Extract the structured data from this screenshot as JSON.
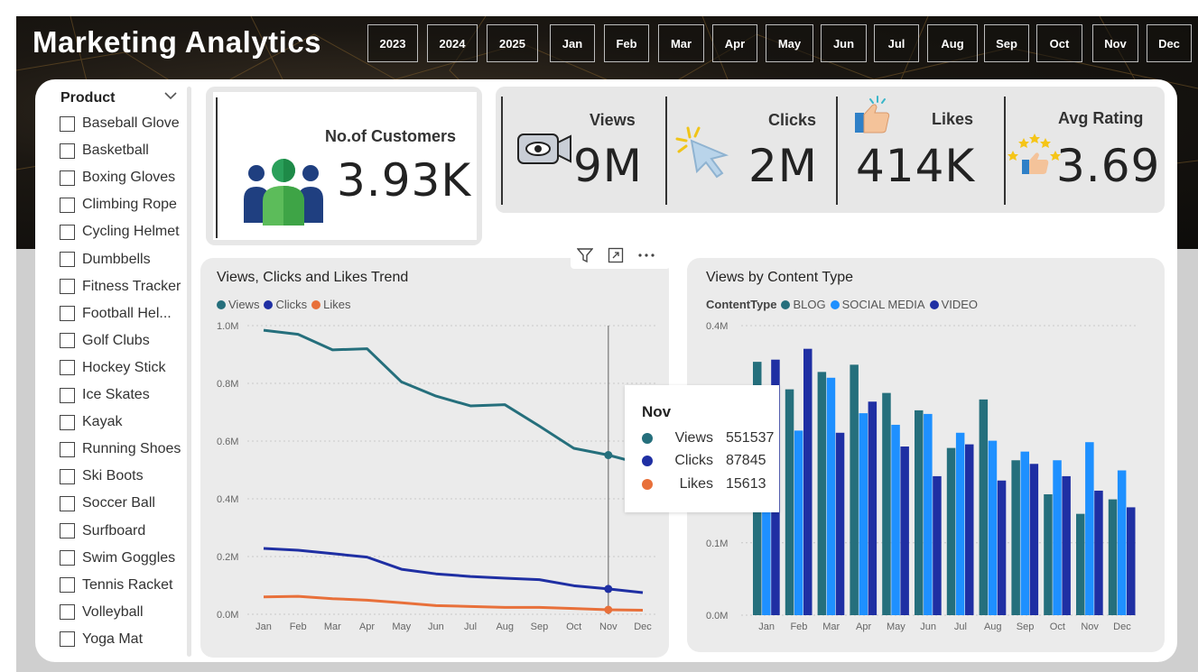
{
  "header": {
    "title": "Marketing Analytics",
    "year_buttons": [
      "2023",
      "2024",
      "2025"
    ],
    "month_buttons": [
      "Jan",
      "Feb",
      "Mar",
      "Apr",
      "May",
      "Jun",
      "Jul",
      "Aug",
      "Sep",
      "Oct",
      "Nov",
      "Dec"
    ]
  },
  "slicer": {
    "title": "Product",
    "chevron_icon": "chevron-down-icon",
    "items": [
      "Baseball Glove",
      "Basketball",
      "Boxing Gloves",
      "Climbing Rope",
      "Cycling Helmet",
      "Dumbbells",
      "Fitness Tracker",
      "Football Hel...",
      "Golf Clubs",
      "Hockey Stick",
      "Ice Skates",
      "Kayak",
      "Running Shoes",
      "Ski Boots",
      "Soccer Ball",
      "Surfboard",
      "Swim Goggles",
      "Tennis Racket",
      "Volleyball",
      "Yoga Mat"
    ]
  },
  "kpis": {
    "customers": {
      "label": "No.of Customers",
      "value": "3.93K",
      "icon": "people-icon"
    },
    "views": {
      "label": "Views",
      "value": "9M",
      "icon": "camera-eye-icon"
    },
    "clicks": {
      "label": "Clicks",
      "value": "2M",
      "icon": "cursor-click-icon"
    },
    "likes": {
      "label": "Likes",
      "value": "414K",
      "icon": "thumbs-up-icon"
    },
    "rating": {
      "label": "Avg Rating",
      "value": "3.69",
      "icon": "star-rating-icon"
    }
  },
  "visual_header_icons": [
    "filter-icon",
    "focus-mode-icon",
    "more-options-icon"
  ],
  "colors": {
    "views": "#256f7c",
    "clicks": "#1f2fa3",
    "likes": "#e8703a",
    "blog": "#256f7c",
    "social_media": "#1e90ff",
    "video": "#1f2fa3"
  },
  "tooltip": {
    "title": "Nov",
    "rows": [
      {
        "name": "Views",
        "value": "551537"
      },
      {
        "name": "Clicks",
        "value": "87845"
      },
      {
        "name": "Likes",
        "value": "15613"
      }
    ]
  },
  "chart_data": [
    {
      "type": "line",
      "title": "Views, Clicks and Likes Trend",
      "categories": [
        "Jan",
        "Feb",
        "Mar",
        "Apr",
        "May",
        "Jun",
        "Jul",
        "Aug",
        "Sep",
        "Oct",
        "Nov",
        "Dec"
      ],
      "yticks": [
        "0.0M",
        "0.2M",
        "0.4M",
        "0.6M",
        "0.8M",
        "1.0M"
      ],
      "ylim": [
        0,
        1000000
      ],
      "legend": "top-left",
      "grid": true,
      "series": [
        {
          "name": "Views",
          "values": [
            984000,
            970000,
            916000,
            920000,
            805000,
            756000,
            722000,
            726000,
            652000,
            575000,
            551537,
            520000
          ]
        },
        {
          "name": "Clicks",
          "values": [
            228000,
            222000,
            210000,
            198000,
            156000,
            140000,
            131000,
            125000,
            120000,
            99000,
            87845,
            75000
          ]
        },
        {
          "name": "Likes",
          "values": [
            60000,
            62000,
            54000,
            49000,
            40000,
            30000,
            27000,
            24000,
            24000,
            20000,
            15613,
            14000
          ]
        }
      ],
      "highlight_category": "Nov"
    },
    {
      "type": "bar",
      "title": "Views by Content Type",
      "legend_title": "ContentType",
      "categories": [
        "Jan",
        "Feb",
        "Mar",
        "Apr",
        "May",
        "Jun",
        "Jul",
        "Aug",
        "Sep",
        "Oct",
        "Nov",
        "Dec"
      ],
      "yticks": [
        "0.0M",
        "0.1M",
        "0.4M"
      ],
      "ylim": [
        0,
        400000
      ],
      "legend": "top-left",
      "grid": true,
      "series": [
        {
          "name": "BLOG",
          "values": [
            350000,
            312000,
            336000,
            346000,
            307000,
            283000,
            231000,
            298000,
            214000,
            167000,
            140000,
            160000
          ]
        },
        {
          "name": "SOCIAL MEDIA",
          "values": [
            195000,
            255000,
            328000,
            279000,
            263000,
            278000,
            252000,
            241000,
            226000,
            214000,
            239000,
            200000
          ]
        },
        {
          "name": "VIDEO",
          "values": [
            353000,
            368000,
            252000,
            295000,
            233000,
            192000,
            236000,
            186000,
            209000,
            192000,
            172000,
            149000
          ]
        }
      ]
    }
  ]
}
